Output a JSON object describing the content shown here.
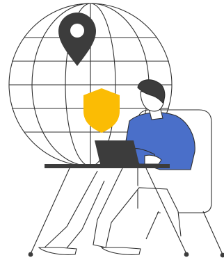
{
  "illustration": {
    "icons": [
      "globe-icon",
      "location-pin-icon",
      "shield-icon",
      "person-icon",
      "laptop-icon",
      "desk-icon",
      "chair-icon"
    ],
    "colors": {
      "line": "#2e2e2e",
      "pin": "#3c3c3c",
      "shield": "#fbbc04",
      "shirt": "#4a6fc9",
      "laptop": "#3c3c3c",
      "hair": "#3c3c3c",
      "skin": "#ffffff",
      "background": "#ffffff"
    }
  }
}
